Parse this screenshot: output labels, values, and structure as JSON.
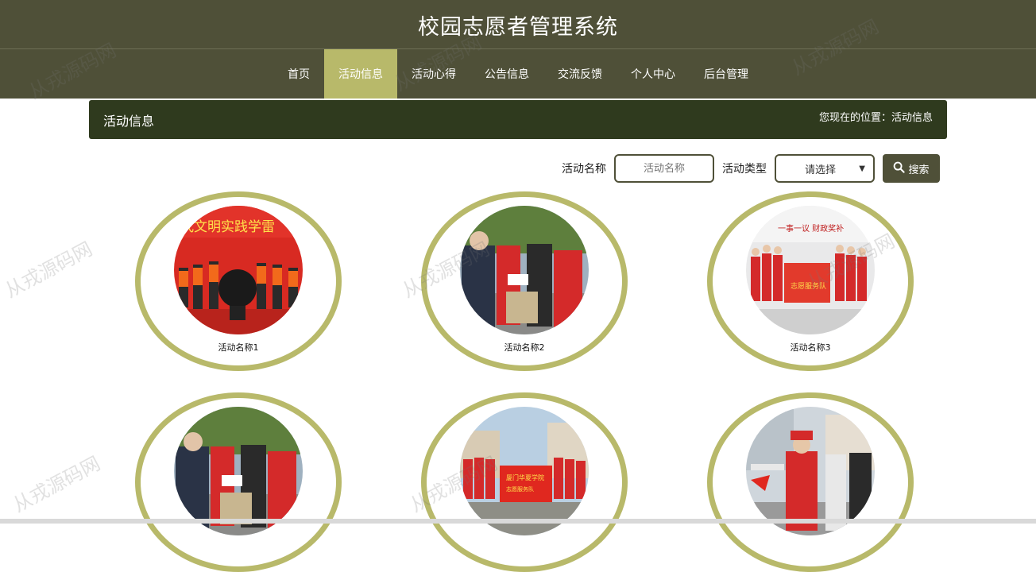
{
  "header": {
    "title": "校园志愿者管理系统"
  },
  "nav": {
    "items": [
      {
        "label": "首页"
      },
      {
        "label": "活动信息"
      },
      {
        "label": "活动心得"
      },
      {
        "label": "公告信息"
      },
      {
        "label": "交流反馈"
      },
      {
        "label": "个人中心"
      },
      {
        "label": "后台管理"
      }
    ],
    "active_index": 1
  },
  "title_bar": {
    "title": "活动信息",
    "location": "您现在的位置：活动信息"
  },
  "search": {
    "name_label": "活动名称",
    "name_placeholder": "活动名称",
    "type_label": "活动类型",
    "type_selected": "请选择",
    "button_label": "搜索"
  },
  "activities": [
    {
      "name": "活动名称1",
      "photo": "ceremony-red-banner"
    },
    {
      "name": "活动名称2",
      "photo": "volunteers-handing-box"
    },
    {
      "name": "活动名称3",
      "photo": "group-with-red-banner"
    },
    {
      "name": "",
      "photo": "volunteers-handing-box"
    },
    {
      "name": "",
      "photo": "group-outdoor-banner"
    },
    {
      "name": "",
      "photo": "volunteers-street-flags"
    }
  ],
  "watermark": "从戎源码网",
  "colors": {
    "header_bg": "#4f5038",
    "accent": "#b8b96a",
    "title_bar_bg": "#2f3a1e"
  }
}
